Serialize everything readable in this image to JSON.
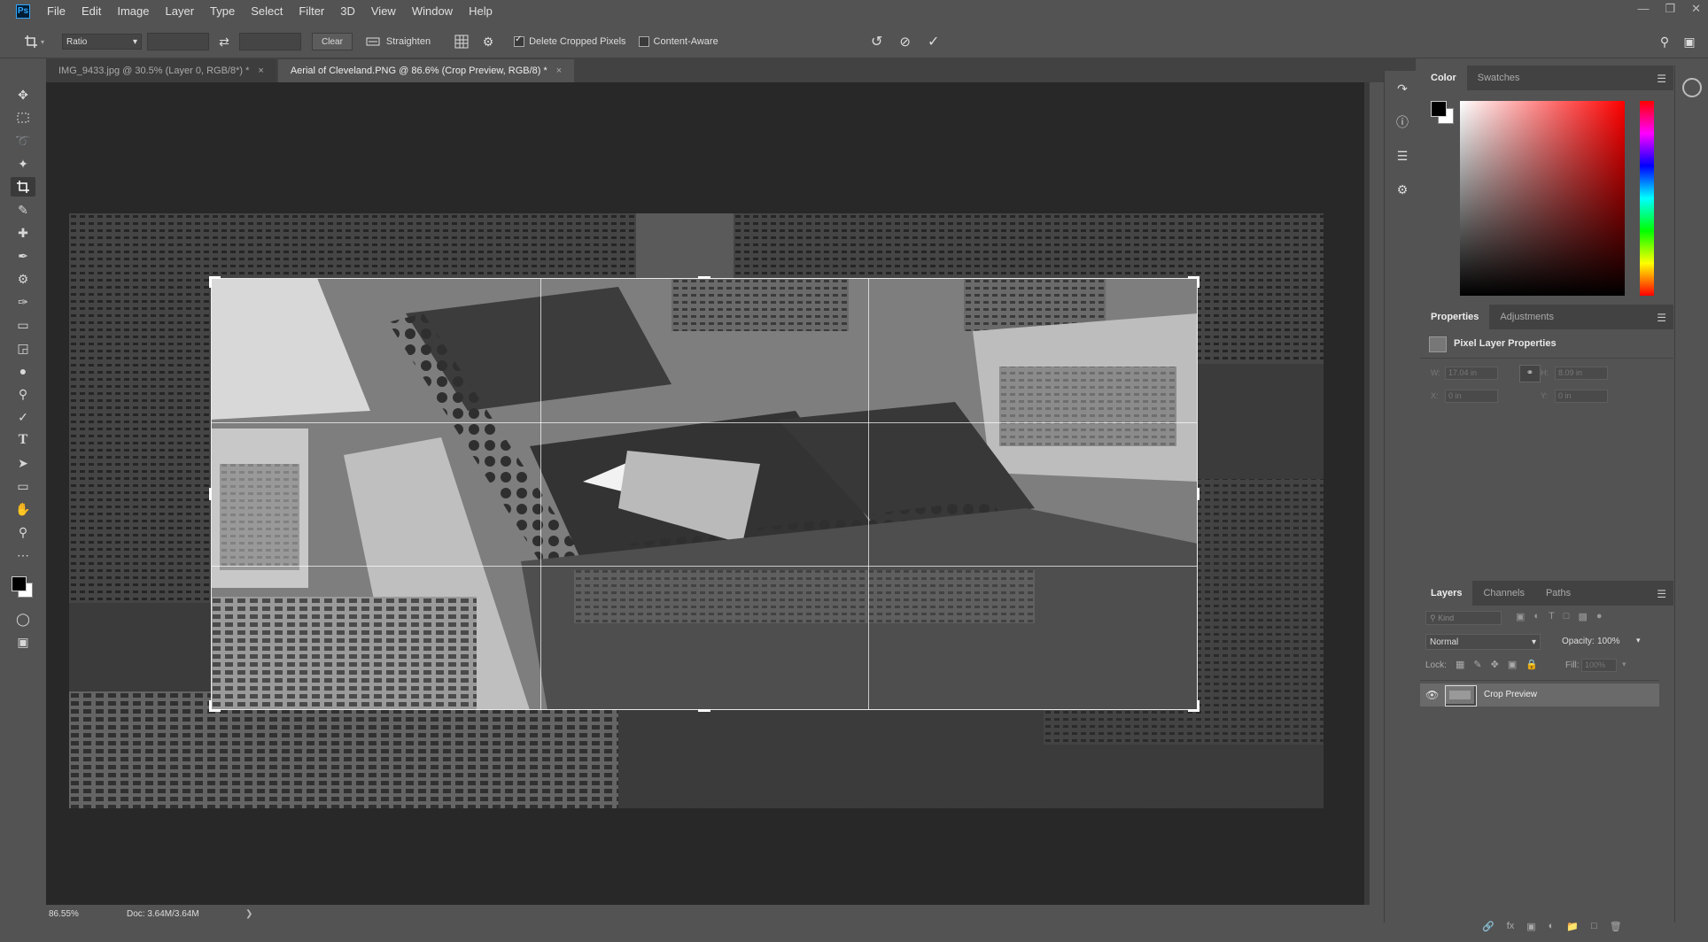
{
  "app": {
    "logo": "Ps"
  },
  "menu": [
    "File",
    "Edit",
    "Image",
    "Layer",
    "Type",
    "Select",
    "Filter",
    "3D",
    "View",
    "Window",
    "Help"
  ],
  "options": {
    "ratio_label": "Ratio",
    "clear_label": "Clear",
    "straighten_label": "Straighten",
    "delete_cropped_label": "Delete Cropped Pixels",
    "delete_cropped_checked": true,
    "content_aware_label": "Content-Aware",
    "content_aware_checked": false
  },
  "tabs": [
    {
      "label": "IMG_9433.jpg @ 30.5% (Layer 0, RGB/8*) *",
      "active": false
    },
    {
      "label": "Aerial of Cleveland.PNG @ 86.6% (Crop Preview, RGB/8) *",
      "active": true
    }
  ],
  "status": {
    "zoom": "86.55%",
    "doc": "Doc: 3.64M/3.64M"
  },
  "color_panel": {
    "tabs": [
      "Color",
      "Swatches"
    ]
  },
  "properties_panel": {
    "tabs": [
      "Properties",
      "Adjustments"
    ],
    "title": "Pixel Layer Properties",
    "w_label": "W:",
    "w_value": "17.04 in",
    "h_label": "H:",
    "h_value": "8.09 in",
    "x_label": "X:",
    "x_value": "0 in",
    "y_label": "Y:",
    "y_value": "0 in"
  },
  "layers_panel": {
    "tabs": [
      "Layers",
      "Channels",
      "Paths"
    ],
    "kind_placeholder": "Kind",
    "blend_mode": "Normal",
    "opacity_label": "Opacity:",
    "opacity_value": "100%",
    "lock_label": "Lock:",
    "fill_label": "Fill:",
    "fill_value": "100%",
    "layers": [
      {
        "name": "Crop Preview",
        "visible": true,
        "selected": true
      }
    ]
  },
  "colors": {
    "ui_bg": "#535353",
    "canvas_bg": "#282828",
    "accent": "#31a8ff"
  }
}
